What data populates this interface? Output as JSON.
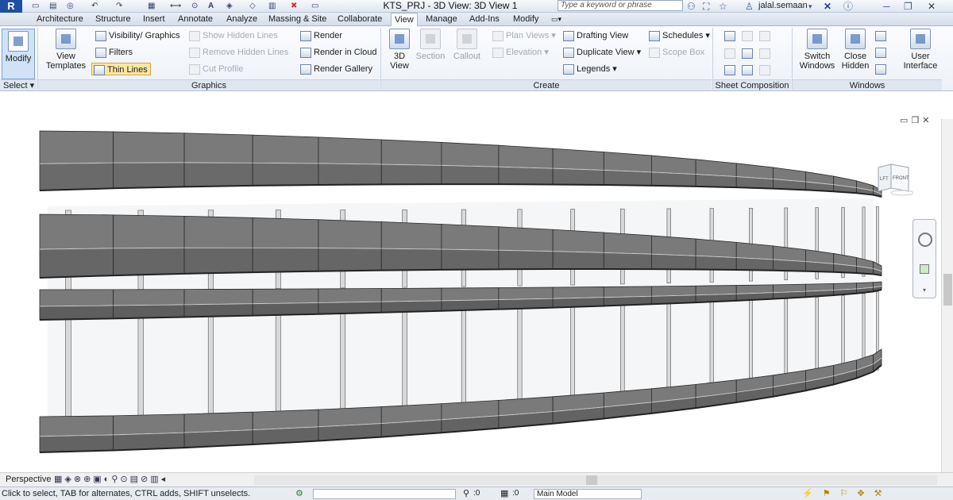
{
  "window": {
    "title": "KTS_PRJ - 3D View: 3D View 1",
    "app_logo": "R",
    "search_placeholder": "Type a keyword or phrase",
    "user": "jalal.semaan"
  },
  "tabs": [
    {
      "label": "Architecture"
    },
    {
      "label": "Structure"
    },
    {
      "label": "Insert"
    },
    {
      "label": "Annotate"
    },
    {
      "label": "Analyze"
    },
    {
      "label": "Massing & Site"
    },
    {
      "label": "Collaborate"
    },
    {
      "label": "View",
      "active": true
    },
    {
      "label": "Manage"
    },
    {
      "label": "Add-Ins"
    },
    {
      "label": "Modify"
    }
  ],
  "ribbon": {
    "select": {
      "modify": "Modify",
      "panel": "Select"
    },
    "graphics": {
      "panel": "Graphics",
      "view_templates": [
        "View",
        "Templates"
      ],
      "visibility_graphics": "Visibility/ Graphics",
      "filters": "Filters",
      "thin_lines": "Thin Lines",
      "show_hidden_lines": "Show Hidden Lines",
      "remove_hidden_lines": "Remove Hidden Lines",
      "cut_profile": "Cut Profile",
      "render": "Render",
      "render_in_cloud": "Render in Cloud",
      "render_gallery": "Render Gallery"
    },
    "create": {
      "panel": "Create",
      "view_3d": [
        "3D",
        "View"
      ],
      "section": "Section",
      "callout": "Callout",
      "plan_views": "Plan Views",
      "elevation": "Elevation",
      "drafting_view": "Drafting View",
      "duplicate_view": "Duplicate View",
      "legends": "Legends",
      "schedules": "Schedules",
      "scope_box": "Scope Box"
    },
    "sheet": {
      "panel": "Sheet Composition"
    },
    "windows": {
      "panel": "Windows",
      "switch_windows": [
        "Switch",
        "Windows"
      ],
      "close_hidden": [
        "Close",
        "Hidden"
      ],
      "user_interface": [
        "User",
        "Interface"
      ]
    }
  },
  "viewcube": {
    "left": "LFT",
    "front": "FRONT"
  },
  "viewbar": {
    "mode": "Perspective"
  },
  "status": {
    "message": "Click to select, TAB for alternates, CTRL adds, SHIFT unselects.",
    "count": ":0",
    "count2": ":0",
    "model": "Main Model"
  }
}
